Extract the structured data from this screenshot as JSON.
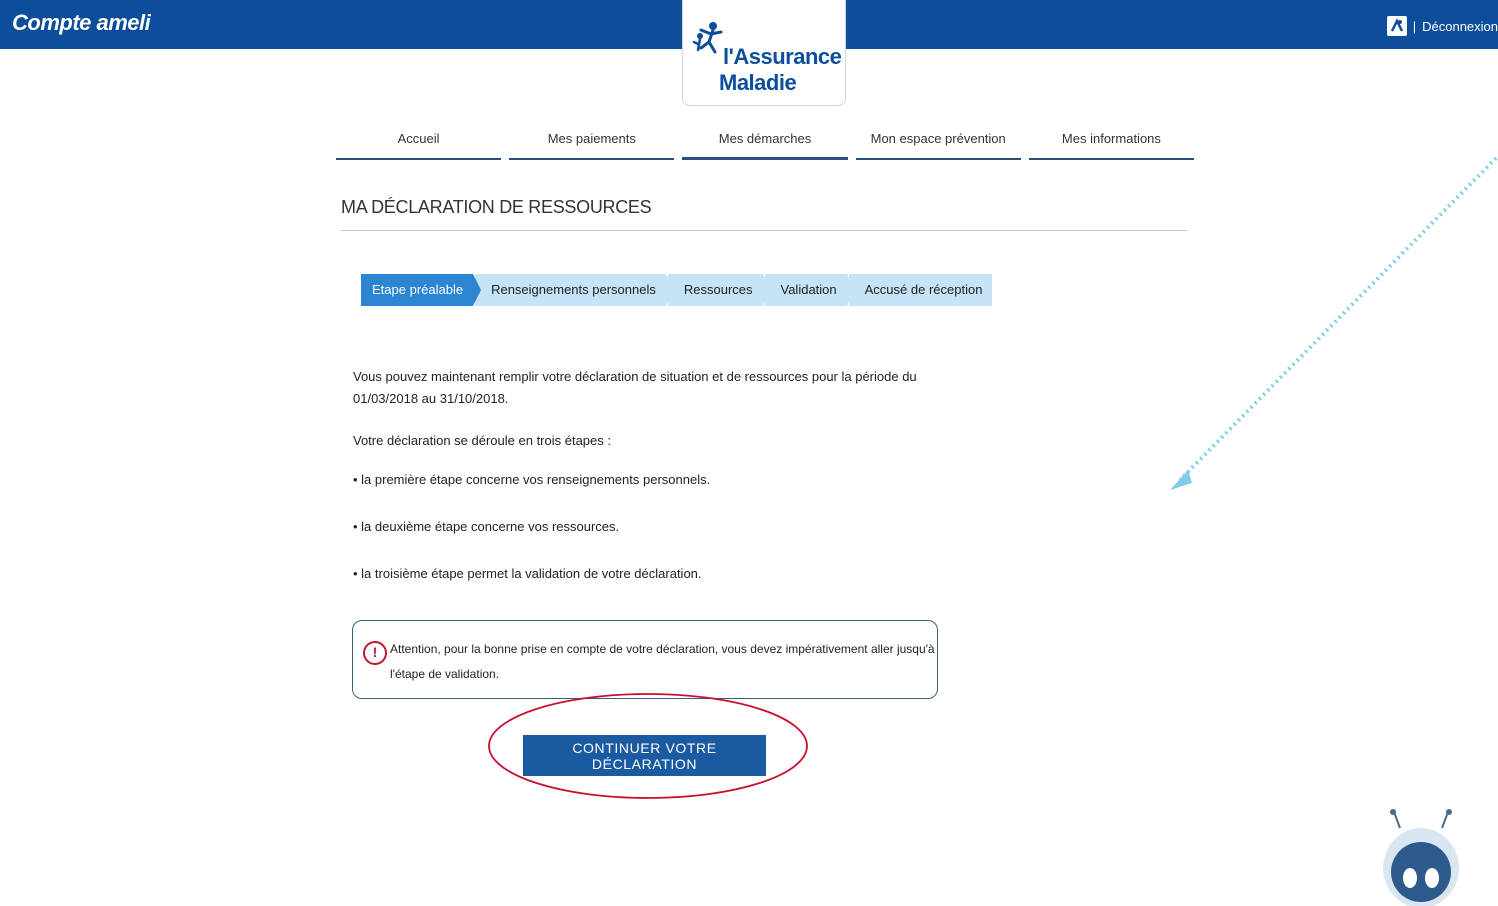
{
  "header": {
    "app_title": "Compte ameli",
    "separator": "|",
    "logout_label": "Déconnexion",
    "brand_line1": "l'Assurance",
    "brand_line2": "Maladie"
  },
  "nav": {
    "tabs": [
      {
        "label": "Accueil"
      },
      {
        "label": "Mes paiements"
      },
      {
        "label": "Mes démarches"
      },
      {
        "label": "Mon espace prévention"
      },
      {
        "label": "Mes informations"
      }
    ]
  },
  "page": {
    "title": "MA DÉCLARATION DE RESSOURCES"
  },
  "stepper": {
    "steps": [
      {
        "label": "Etape préalable",
        "active": true
      },
      {
        "label": "Renseignements personnels"
      },
      {
        "label": "Ressources"
      },
      {
        "label": "Validation"
      },
      {
        "label": "Accusé de réception"
      }
    ]
  },
  "content": {
    "intro": "Vous pouvez maintenant remplir votre déclaration de situation et de ressources pour la période du 01/03/2018 au 31/10/2018.",
    "steps_intro": "Votre déclaration se déroule en trois étapes :",
    "bullets": [
      "• la première étape concerne vos renseignements personnels.",
      "• la deuxième étape concerne vos ressources.",
      "• la troisième étape permet la validation de votre déclaration."
    ],
    "alert": "Attention, pour la bonne prise en compte de votre déclaration, vous devez impérativement aller jusqu'à l'étape de validation.",
    "alert_icon": "!",
    "continue_button": "CONTINUER VOTRE DÉCLARATION"
  },
  "colors": {
    "header_blue": "#0c4e9c",
    "step_active": "#2b85d3",
    "step_inactive": "#c6e3f7",
    "button": "#1a5aa0",
    "alert_red": "#c0182d",
    "annotation_red": "#c8102e",
    "annotation_arrow": "#7fcbe8"
  },
  "icons": [
    "accessibility-icon",
    "brand-figures-icon",
    "warning-icon",
    "chat-bot-icon"
  ]
}
